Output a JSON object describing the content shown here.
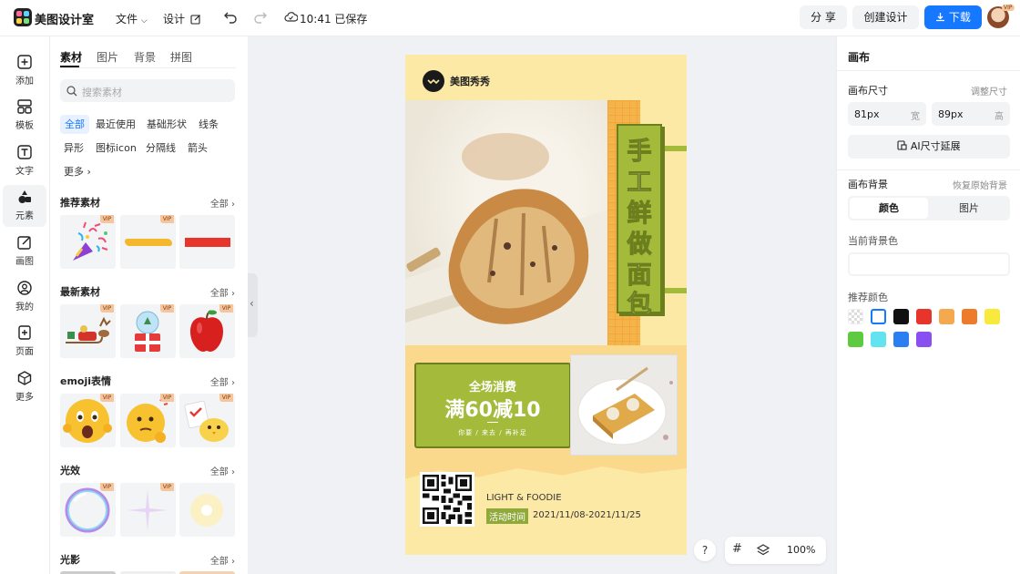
{
  "app": {
    "name": "美图设计室",
    "file_menu": "文件",
    "design_menu": "设计",
    "save_status": "10:41 已保存"
  },
  "toolbar": {
    "share": "分 享",
    "create": "创建设计",
    "download": "下载",
    "avatar_badge": "VIP"
  },
  "leftnav": [
    {
      "label": "添加",
      "icon": "add-icon"
    },
    {
      "label": "模板",
      "icon": "template-icon"
    },
    {
      "label": "文字",
      "icon": "text-icon"
    },
    {
      "label": "元素",
      "icon": "element-icon"
    },
    {
      "label": "画图",
      "icon": "draw-icon"
    },
    {
      "label": "我的",
      "icon": "user-icon"
    },
    {
      "label": "页面",
      "icon": "page-icon"
    },
    {
      "label": "更多",
      "icon": "more-icon"
    }
  ],
  "panel": {
    "tabs": [
      "素材",
      "图片",
      "背景",
      "拼图"
    ],
    "search_placeholder": "搜索素材",
    "chips": [
      "全部",
      "最近使用",
      "基础形状",
      "线条",
      "异形",
      "图标icon",
      "分隔线",
      "箭头",
      "更多"
    ],
    "sections": [
      {
        "title": "推荐素材",
        "all": "全部"
      },
      {
        "title": "最新素材",
        "all": "全部"
      },
      {
        "title": "emoji表情",
        "all": "全部"
      },
      {
        "title": "光效",
        "all": "全部"
      },
      {
        "title": "光影",
        "all": "全部"
      }
    ],
    "vip": "VIP"
  },
  "poster": {
    "brand": "美图秀秀",
    "headline": [
      "手",
      "工",
      "鲜",
      "做",
      "面",
      "包"
    ],
    "promo_line1": "全场消费",
    "promo_line2": "满60减10",
    "promo_line3": "你要 / 来去 / 再补足",
    "brand_en": "LIGHT & FOODIE",
    "activity_label": "活动时间",
    "activity_date": "2021/11/08-2021/11/25"
  },
  "canvas_controls": {
    "help": "?",
    "zoom": "100%"
  },
  "right": {
    "title": "画布",
    "size_label": "画布尺寸",
    "size_adjust": "调整尺寸",
    "width_value": "81px",
    "width_unit": "宽",
    "height_value": "89px",
    "height_unit": "高",
    "ai_extend": "AI尺寸延展",
    "bg_label": "画布背景",
    "bg_restore": "恢复原始背景",
    "bg_tab_color": "颜色",
    "bg_tab_image": "图片",
    "current_bg": "当前背景色",
    "recommend": "推荐颜色",
    "swatches": [
      "transparent",
      "#ffffff",
      "#111111",
      "#e8352b",
      "#f5a94e",
      "#ee7a2b",
      "#f7ea3c",
      "#5ccb3f",
      "#62e3f0",
      "#2b7ff0",
      "#8a4ff0"
    ]
  },
  "colors": {
    "accent": "#1677ff",
    "poster_bg": "#fde9a6",
    "poster_green": "#a3ba3a"
  }
}
